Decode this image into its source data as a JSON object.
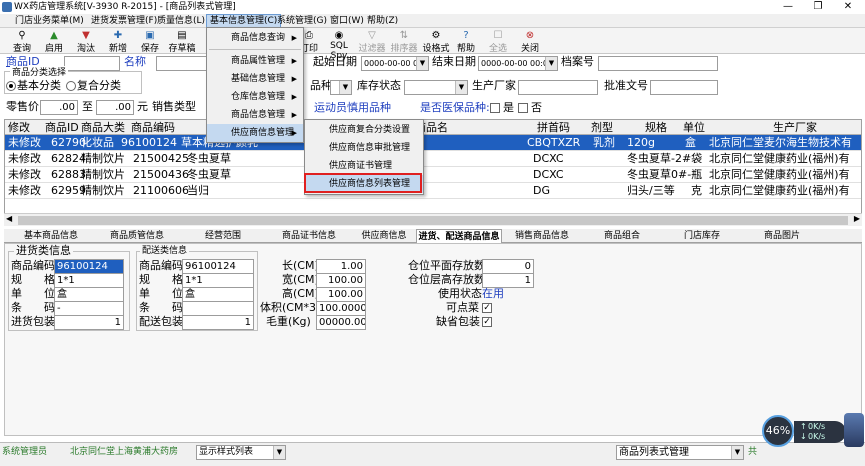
{
  "window": {
    "title": "WX药店管理系统[V-3930 R-2015] - [商品列表式管理]",
    "min": "—",
    "max": "❐",
    "close": "✕"
  },
  "menubar": [
    "门店业务菜单(M)",
    "进货发票管理(F)",
    "质量信息(L)",
    "基本信息管理(C)",
    "系统管理(G)",
    "窗口(W)",
    "帮助(Z)"
  ],
  "toolbar": [
    {
      "label": "查询",
      "icon": "binoculars-icon",
      "glyph": "⚲"
    },
    {
      "label": "启用",
      "icon": "enable-icon",
      "glyph": "▲"
    },
    {
      "label": "淘汰",
      "icon": "discard-icon",
      "glyph": "▼"
    },
    {
      "label": "新增",
      "icon": "add-icon",
      "glyph": "✚"
    },
    {
      "label": "保存",
      "icon": "save-icon",
      "glyph": "▣"
    },
    {
      "label": "存草稿",
      "icon": "draft-icon",
      "glyph": "▤"
    },
    {
      "label": "打印",
      "icon": "print-icon",
      "glyph": "⎙"
    },
    {
      "label": "SQL Spy",
      "icon": "sql-spy-icon",
      "glyph": "◉"
    },
    {
      "label": "过滤器",
      "icon": "filter-icon",
      "glyph": "▽"
    },
    {
      "label": "排序器",
      "icon": "sort-icon",
      "glyph": "⇅"
    },
    {
      "label": "设格式",
      "icon": "format-icon",
      "glyph": "⚙"
    },
    {
      "label": "帮助",
      "icon": "help-icon",
      "glyph": "?"
    },
    {
      "label": "全选",
      "icon": "select-all-icon",
      "glyph": "☐"
    },
    {
      "label": "关闭",
      "icon": "close-icon",
      "glyph": "⊗"
    }
  ],
  "filters": {
    "goods_id_label": "商品ID",
    "name_label": "名称",
    "category_group": "商品分类选择",
    "basic_category": "基本分类",
    "composite_category": "复合分类",
    "retail_price_label": "零售价",
    "price_from": ".00",
    "to_label": "至",
    "price_to": ".00",
    "yuan_label": "元",
    "sales_type_label": "销售类型",
    "start_date_label": "起始日期",
    "start_date": "0000-00-00 00:00:00",
    "end_date_label": "结束日期",
    "end_date": "0000-00-00 00:00:00",
    "archive_no_label": "档案号",
    "product_type_label": "品种",
    "stock_status_label": "库存状态",
    "manufacturer_label": "生产厂家",
    "approval_no_label": "批准文号",
    "athlete_drug_label": "运动员慎用品种",
    "medical_insurance_label": "是否医保品种:",
    "yes": "是",
    "no": "否"
  },
  "grid": {
    "headers": [
      "修改",
      "商品ID",
      "商品大类",
      "商品编码",
      "商品名",
      "拼首码",
      "剂型",
      "规格",
      "单位",
      "生产厂家"
    ],
    "rows": [
      [
        "未修改",
        "62790",
        "化妆品",
        "96100124",
        "草本精选护颜乳",
        "CBQTXZR",
        "乳剂",
        "120g",
        "盒",
        "北京同仁堂麦尔海生物技术有"
      ],
      [
        "未修改",
        "62824",
        "精制饮片",
        "21500425",
        "冬虫夏草",
        "DCXC",
        "",
        "冬虫夏草-2#袋",
        "",
        "北京同仁堂健康药业(福州)有"
      ],
      [
        "未修改",
        "62883",
        "精制饮片",
        "21500436",
        "冬虫夏草",
        "DCXC",
        "",
        "冬虫夏草0#-瓶",
        "",
        "北京同仁堂健康药业(福州)有"
      ],
      [
        "未修改",
        "62959",
        "精制饮片",
        "21100606",
        "当归",
        "DG",
        "",
        "归头/三等",
        "克",
        "北京同仁堂健康药业(福州)有"
      ]
    ]
  },
  "tabs": [
    "基本商品信息",
    "商品质管信息",
    "经营范围",
    "商品证书信息",
    "供应商信息",
    "进货、配送商品信息",
    "销售商品信息",
    "商品组合",
    "门店库存",
    "商品图片"
  ],
  "detail": {
    "purchase_group": "进货类信息",
    "delivery_group": "配送类信息",
    "p_code_label": "商品编码",
    "p_code": "96100124",
    "p_spec_label": "规　　格",
    "p_spec": "1*1",
    "p_unit_label": "单　　位",
    "p_unit": "盒",
    "p_barcode_label": "条　　码",
    "p_barcode": "-",
    "p_pack_label": "进货包装",
    "p_pack": "1",
    "d_code_label": "商品编码",
    "d_code": "96100124",
    "d_spec_label": "规　　格",
    "d_spec": "1*1",
    "d_unit_label": "单　　位",
    "d_unit": "盒",
    "d_barcode_label": "条　　码",
    "d_barcode": "",
    "d_pack_label": "配送包装",
    "d_pack": "1",
    "length_label": "长(CM)",
    "length": "1.00",
    "width_label": "宽(CM)",
    "width": "100.00",
    "height_label": "高(CM)",
    "height": "100.00",
    "volume_label": "体积(CM*3)",
    "volume": "100.0000",
    "weight_label": "毛重(Kg)",
    "weight": "00000.0000",
    "flat_qty_label": "仓位平面存放数",
    "flat_qty": "0",
    "layer_qty_label": "仓位层高存放数",
    "layer_qty": "1",
    "status_label": "使用状态",
    "status": "在用",
    "dismantle_label": "可点菜",
    "short_pack_label": "缺省包装"
  },
  "dropdown": {
    "level1": [
      "商品信息查询",
      "商品属性管理",
      "基础信息管理",
      "仓库信息管理",
      "商品信息管理",
      "供应商信息管理"
    ],
    "level2": [
      "供应商复合分类设置",
      "供应商信息审批管理",
      "供应商证书管理",
      "供应商信息列表管理"
    ]
  },
  "status": {
    "user": "系统管理员",
    "store": "北京同仁堂上海黄浦大药房",
    "view_mode": "显示样式列表",
    "current_module": "商品列表式管理",
    "right_label": "共",
    "cpu_percent": "46%",
    "net_up": "0K/s",
    "net_down": "0K/s"
  }
}
